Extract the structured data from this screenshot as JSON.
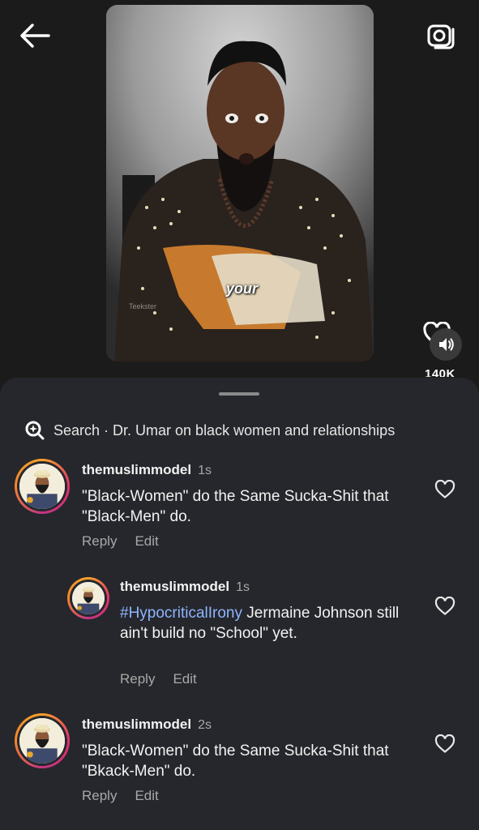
{
  "video": {
    "caption_word": "your",
    "watermark": "Teekster"
  },
  "side_actions": {
    "like_count": "140K"
  },
  "search": {
    "label": "Search · Dr. Umar on black women and relationships"
  },
  "comments": [
    {
      "username": "themuslimmodel",
      "time": "1s",
      "text": "\"Black-Women\" do the Same Sucka-Shit that \"Black-Men\" do.",
      "reply_label": "Reply",
      "edit_label": "Edit"
    },
    {
      "username": "themuslimmodel",
      "time": "1s",
      "hashtag": "#HypocriticalIrony",
      "text": " Jermaine Johnson still ain't build no \"School\" yet.",
      "reply_label": "Reply",
      "edit_label": "Edit"
    },
    {
      "username": "themuslimmodel",
      "time": "2s",
      "text": "\"Black-Women\" do the Same Sucka-Shit that \"Bkack-Men\" do.",
      "reply_label": "Reply",
      "edit_label": "Edit"
    }
  ],
  "colors": {
    "background": "#1b1b1b",
    "sheet": "#25272c",
    "hashtag": "#8fb4ff",
    "muted_text": "#a8a8a8"
  },
  "icons": [
    "back-arrow-icon",
    "camera-icon",
    "heart-icon",
    "speaker-icon",
    "search-icon"
  ]
}
